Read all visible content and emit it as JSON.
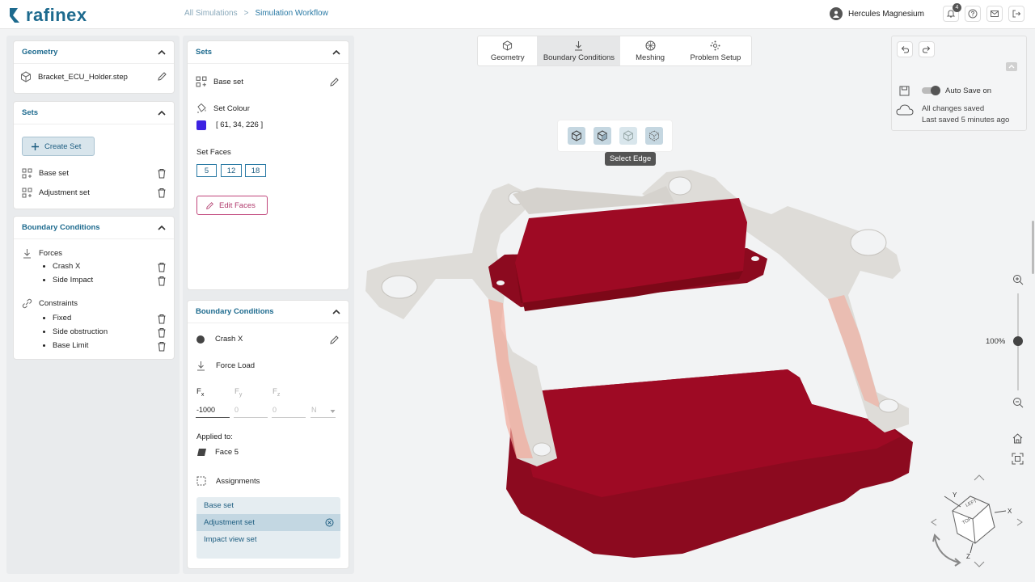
{
  "app": {
    "logo_text": "rafinex"
  },
  "breadcrumb": {
    "items": [
      "All Simulations",
      ">",
      "Simulation Workflow"
    ]
  },
  "user": {
    "name": "Hercules Magnesium",
    "notifications": "4"
  },
  "geometry_panel": {
    "title": "Geometry",
    "file": "Bracket_ECU_Holder.step"
  },
  "sets_panel": {
    "title": "Sets",
    "create_label": "Create Set",
    "items": [
      "Base set",
      "Adjustment set"
    ]
  },
  "bc_panel": {
    "title": "Boundary Conditions",
    "forces_label": "Forces",
    "forces": [
      "Crash X",
      "Side Impact"
    ],
    "constraints_label": "Constraints",
    "constraints": [
      "Fixed",
      "Side obstruction",
      "Base Limit"
    ]
  },
  "set_detail": {
    "title": "Sets",
    "name": "Base set",
    "colour_label": "Set Colour",
    "colour_value": "[ 61, 34, 226 ]",
    "colour_hex": "#3d22e2",
    "faces_label": "Set Faces",
    "faces": [
      "5",
      "12",
      "18"
    ],
    "edit_label": "Edit Faces"
  },
  "bc_detail": {
    "title": "Boundary Conditions",
    "name": "Crash X",
    "load_type": "Force Load",
    "fx_label": "F",
    "fx_sub": "x",
    "fy_label": "F",
    "fy_sub": "y",
    "fz_label": "F",
    "fz_sub": "z",
    "fx_value": "-1000",
    "fy_value": "0",
    "fz_value": "0",
    "unit": "N",
    "applied_label": "Applied to:",
    "applied_value": "Face 5",
    "assignments_label": "Assignments",
    "assignments": [
      "Base set",
      "Adjustment set",
      "Impact view set"
    ]
  },
  "workflow_tabs": [
    "Geometry",
    "Boundary Conditions",
    "Meshing",
    "Problem Setup"
  ],
  "active_tab": "Boundary Conditions",
  "selection_tool": {
    "tooltip": "Select Edge"
  },
  "autosave": {
    "label": "Auto Save on",
    "status": "All changes saved",
    "last": "Last saved 5 minutes ago"
  },
  "zoom": {
    "value": "100%"
  },
  "viewcube": {
    "top": "TOP",
    "left": "LEFT",
    "x": "X",
    "y": "Y",
    "z": "Z"
  },
  "colors": {
    "accent": "#1d6a8e",
    "model_red": "#9e0a24",
    "model_grey": "#dedcd8"
  }
}
